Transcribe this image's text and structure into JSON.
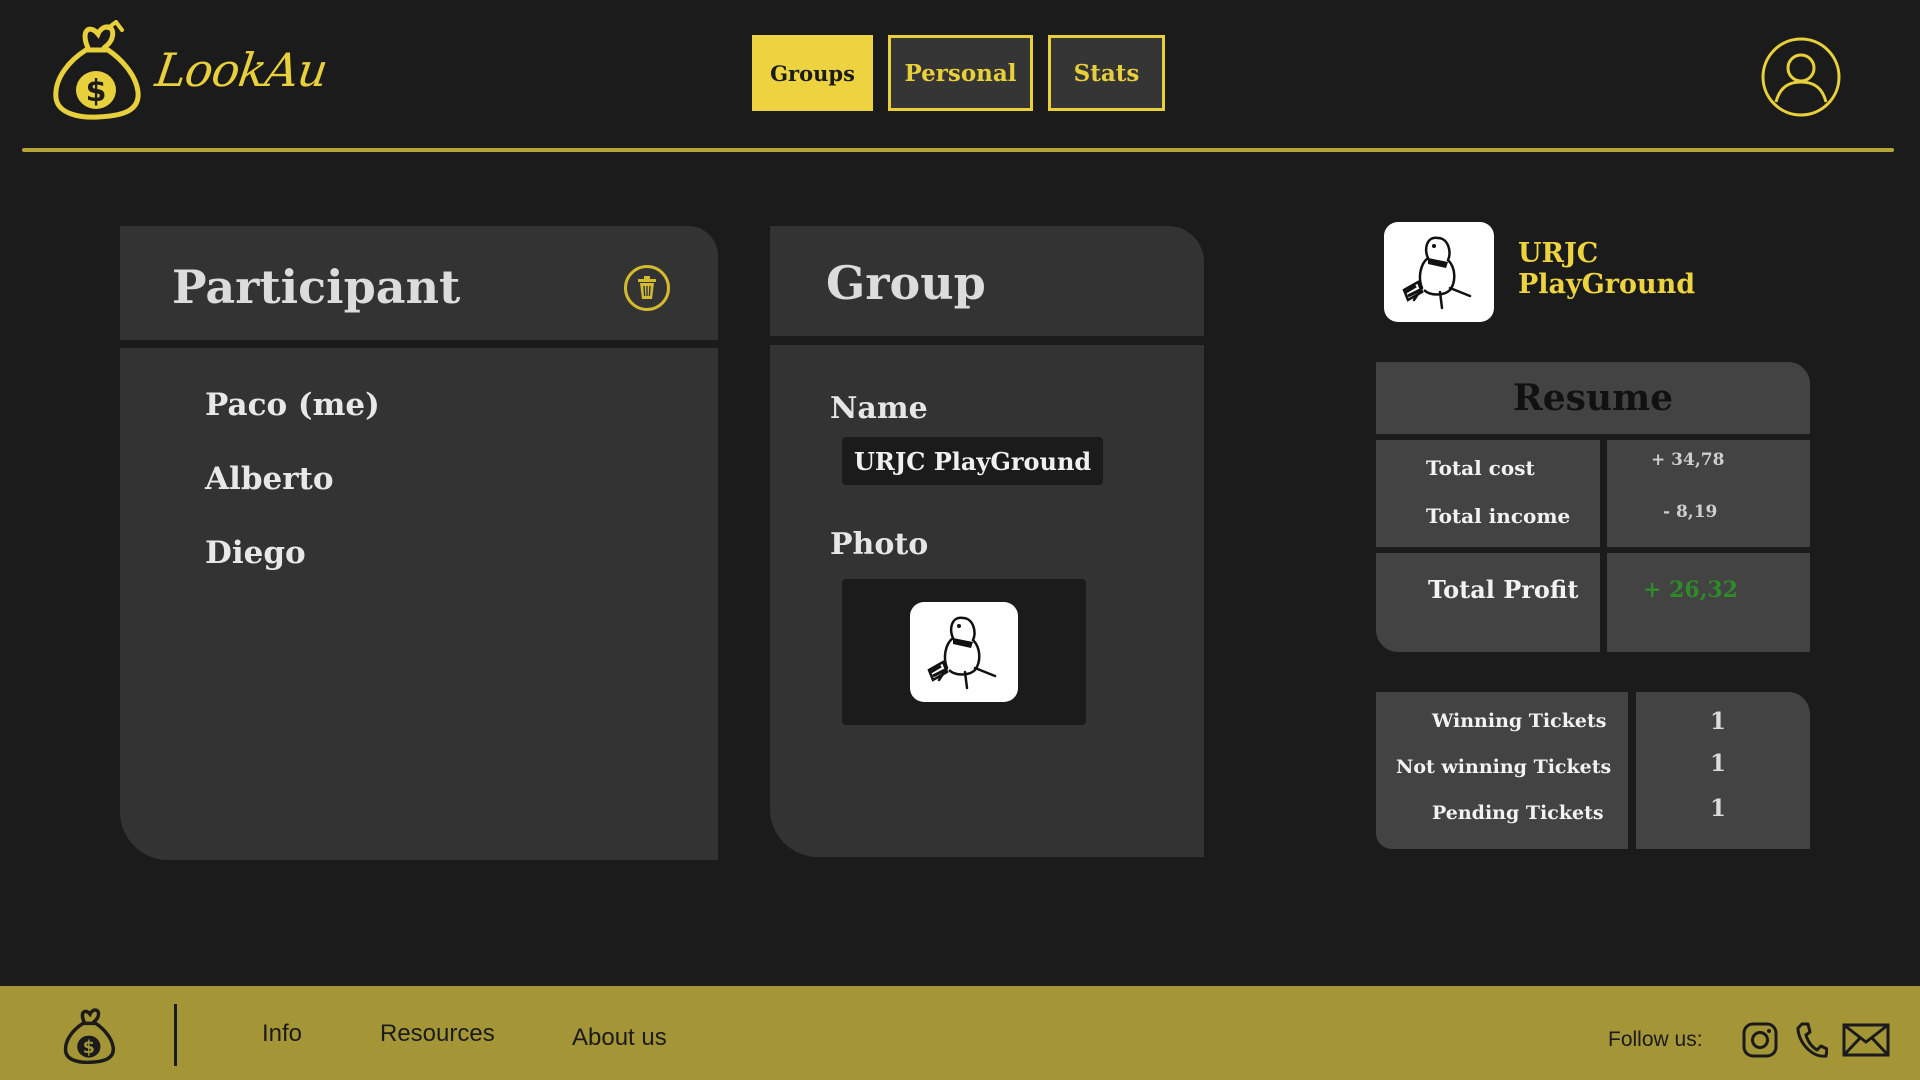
{
  "app": {
    "brand": "LookAu",
    "colors": {
      "accent": "#ecd33f",
      "background": "#1b1b1c",
      "card": "#333334",
      "panel": "#434344",
      "footer": "#a49636",
      "profit": "#2f8a2a"
    }
  },
  "nav": {
    "tabs": [
      {
        "label": "Groups",
        "active": true
      },
      {
        "label": "Personal",
        "active": false
      },
      {
        "label": "Stats",
        "active": false
      }
    ]
  },
  "header": {
    "avatar_icon": "user-circle-icon"
  },
  "participant": {
    "title": "Participant",
    "delete_icon": "trash-icon",
    "members": [
      "Paco (me)",
      "Alberto",
      "Diego"
    ]
  },
  "group": {
    "title": "Group",
    "name_label": "Name",
    "name_value": "URJC PlayGround",
    "photo_label": "Photo",
    "photo_icon": "penguin-avatar-icon"
  },
  "summary": {
    "group_name": "URJC PlayGround",
    "resume_title": "Resume",
    "total_cost_label": "Total cost",
    "total_cost_value": "+ 34,78",
    "total_income_label": "Total income",
    "total_income_value": "- 8,19",
    "total_profit_label": "Total Profit",
    "total_profit_value": "+ 26,32",
    "tickets": [
      {
        "label": "Winning Tickets",
        "count": "1"
      },
      {
        "label": "Not winning Tickets",
        "count": "1"
      },
      {
        "label": "Pending Tickets",
        "count": "1"
      }
    ]
  },
  "footer": {
    "links": [
      "Info",
      "Resources",
      "About us"
    ],
    "follow_label": "Follow  us:",
    "social_icons": [
      "instagram-icon",
      "phone-icon",
      "mail-icon"
    ]
  }
}
